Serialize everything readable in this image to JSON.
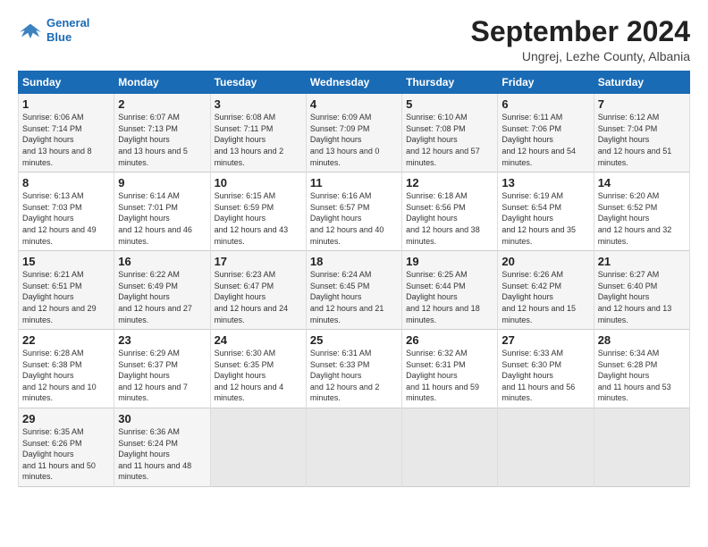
{
  "logo": {
    "line1": "General",
    "line2": "Blue"
  },
  "title": "September 2024",
  "subtitle": "Ungrej, Lezhe County, Albania",
  "days_of_week": [
    "Sunday",
    "Monday",
    "Tuesday",
    "Wednesday",
    "Thursday",
    "Friday",
    "Saturday"
  ],
  "weeks": [
    [
      {
        "day": "1",
        "sunrise": "6:06 AM",
        "sunset": "7:14 PM",
        "daylight": "13 hours and 8 minutes."
      },
      {
        "day": "2",
        "sunrise": "6:07 AM",
        "sunset": "7:13 PM",
        "daylight": "13 hours and 5 minutes."
      },
      {
        "day": "3",
        "sunrise": "6:08 AM",
        "sunset": "7:11 PM",
        "daylight": "13 hours and 2 minutes."
      },
      {
        "day": "4",
        "sunrise": "6:09 AM",
        "sunset": "7:09 PM",
        "daylight": "13 hours and 0 minutes."
      },
      {
        "day": "5",
        "sunrise": "6:10 AM",
        "sunset": "7:08 PM",
        "daylight": "12 hours and 57 minutes."
      },
      {
        "day": "6",
        "sunrise": "6:11 AM",
        "sunset": "7:06 PM",
        "daylight": "12 hours and 54 minutes."
      },
      {
        "day": "7",
        "sunrise": "6:12 AM",
        "sunset": "7:04 PM",
        "daylight": "12 hours and 51 minutes."
      }
    ],
    [
      {
        "day": "8",
        "sunrise": "6:13 AM",
        "sunset": "7:03 PM",
        "daylight": "12 hours and 49 minutes."
      },
      {
        "day": "9",
        "sunrise": "6:14 AM",
        "sunset": "7:01 PM",
        "daylight": "12 hours and 46 minutes."
      },
      {
        "day": "10",
        "sunrise": "6:15 AM",
        "sunset": "6:59 PM",
        "daylight": "12 hours and 43 minutes."
      },
      {
        "day": "11",
        "sunrise": "6:16 AM",
        "sunset": "6:57 PM",
        "daylight": "12 hours and 40 minutes."
      },
      {
        "day": "12",
        "sunrise": "6:18 AM",
        "sunset": "6:56 PM",
        "daylight": "12 hours and 38 minutes."
      },
      {
        "day": "13",
        "sunrise": "6:19 AM",
        "sunset": "6:54 PM",
        "daylight": "12 hours and 35 minutes."
      },
      {
        "day": "14",
        "sunrise": "6:20 AM",
        "sunset": "6:52 PM",
        "daylight": "12 hours and 32 minutes."
      }
    ],
    [
      {
        "day": "15",
        "sunrise": "6:21 AM",
        "sunset": "6:51 PM",
        "daylight": "12 hours and 29 minutes."
      },
      {
        "day": "16",
        "sunrise": "6:22 AM",
        "sunset": "6:49 PM",
        "daylight": "12 hours and 27 minutes."
      },
      {
        "day": "17",
        "sunrise": "6:23 AM",
        "sunset": "6:47 PM",
        "daylight": "12 hours and 24 minutes."
      },
      {
        "day": "18",
        "sunrise": "6:24 AM",
        "sunset": "6:45 PM",
        "daylight": "12 hours and 21 minutes."
      },
      {
        "day": "19",
        "sunrise": "6:25 AM",
        "sunset": "6:44 PM",
        "daylight": "12 hours and 18 minutes."
      },
      {
        "day": "20",
        "sunrise": "6:26 AM",
        "sunset": "6:42 PM",
        "daylight": "12 hours and 15 minutes."
      },
      {
        "day": "21",
        "sunrise": "6:27 AM",
        "sunset": "6:40 PM",
        "daylight": "12 hours and 13 minutes."
      }
    ],
    [
      {
        "day": "22",
        "sunrise": "6:28 AM",
        "sunset": "6:38 PM",
        "daylight": "12 hours and 10 minutes."
      },
      {
        "day": "23",
        "sunrise": "6:29 AM",
        "sunset": "6:37 PM",
        "daylight": "12 hours and 7 minutes."
      },
      {
        "day": "24",
        "sunrise": "6:30 AM",
        "sunset": "6:35 PM",
        "daylight": "12 hours and 4 minutes."
      },
      {
        "day": "25",
        "sunrise": "6:31 AM",
        "sunset": "6:33 PM",
        "daylight": "12 hours and 2 minutes."
      },
      {
        "day": "26",
        "sunrise": "6:32 AM",
        "sunset": "6:31 PM",
        "daylight": "11 hours and 59 minutes."
      },
      {
        "day": "27",
        "sunrise": "6:33 AM",
        "sunset": "6:30 PM",
        "daylight": "11 hours and 56 minutes."
      },
      {
        "day": "28",
        "sunrise": "6:34 AM",
        "sunset": "6:28 PM",
        "daylight": "11 hours and 53 minutes."
      }
    ],
    [
      {
        "day": "29",
        "sunrise": "6:35 AM",
        "sunset": "6:26 PM",
        "daylight": "11 hours and 50 minutes."
      },
      {
        "day": "30",
        "sunrise": "6:36 AM",
        "sunset": "6:24 PM",
        "daylight": "11 hours and 48 minutes."
      },
      null,
      null,
      null,
      null,
      null
    ]
  ]
}
